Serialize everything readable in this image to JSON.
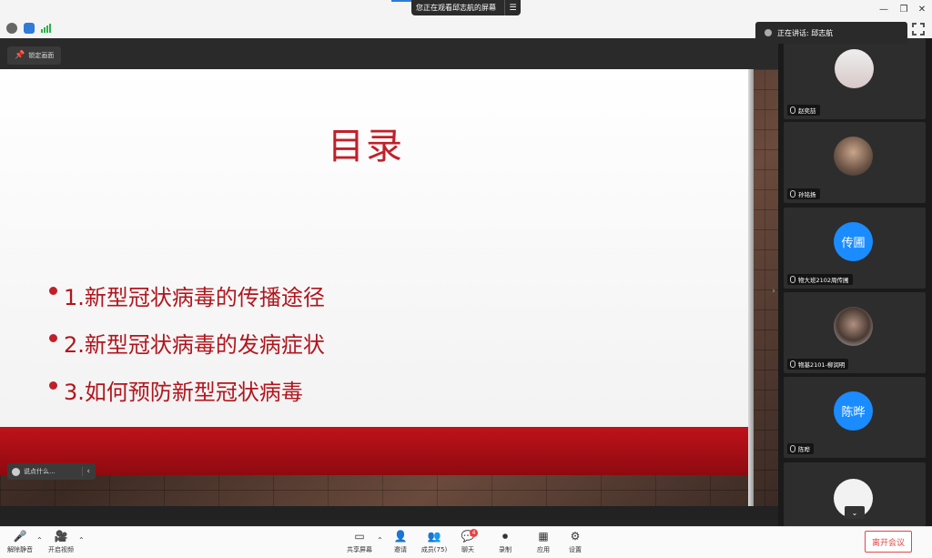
{
  "banner": {
    "text": "您正在观看邱志航的屏幕",
    "menu_icon": "list-icon"
  },
  "window_controls": {
    "minimize": "—",
    "restore": "❐",
    "close": "✕"
  },
  "lock_screen": {
    "label": "锁定画面",
    "icon": "pin-icon"
  },
  "slide": {
    "title": "目录",
    "bullets": [
      "1.新型冠状病毒的传播途径",
      "2.新型冠状病毒的发病症状",
      "3.如何预防新型冠状病毒"
    ]
  },
  "chat_input": {
    "placeholder": "说点什么...",
    "collapse": "‹"
  },
  "speaking": {
    "text": "正在讲话: 邱志航"
  },
  "participants": [
    {
      "name": "赵奕喆",
      "avatar_text": ""
    },
    {
      "name": "孙铭扬",
      "avatar_text": ""
    },
    {
      "name": "物大班2102周传圃",
      "avatar_text": "传圃"
    },
    {
      "name": "物基2101-柳润明",
      "avatar_text": ""
    },
    {
      "name": "陈晔",
      "avatar_text": "陈晔"
    },
    {
      "name": "",
      "avatar_text": ""
    }
  ],
  "toolbar": {
    "unmute": "解除静音",
    "start_video": "开启视频",
    "share_screen": "共享屏幕",
    "invite": "邀请",
    "members": "成员(75)",
    "chat": "聊天",
    "chat_badge": "4",
    "record": "录制",
    "apps": "应用",
    "settings": "设置",
    "leave": "离开会议"
  },
  "colors": {
    "accent": "#1a8cff",
    "slide_red": "#c0202a",
    "leave_red": "#e04848"
  }
}
